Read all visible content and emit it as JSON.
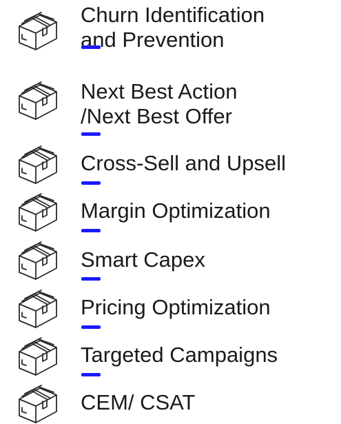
{
  "accent_color": "#1a1aff",
  "icon_name": "package-box-icon",
  "items": [
    {
      "line1": "Churn Identification",
      "line2": "and Prevention"
    },
    {
      "line1": "Next Best Action",
      "line2": "/Next Best Offer"
    },
    {
      "line1": "Cross-Sell and Upsell",
      "line2": ""
    },
    {
      "line1": "Margin Optimization",
      "line2": ""
    },
    {
      "line1": "Smart Capex",
      "line2": ""
    },
    {
      "line1": "Pricing Optimization",
      "line2": ""
    },
    {
      "line1": "Targeted Campaigns",
      "line2": ""
    },
    {
      "line1": "CEM/ CSAT",
      "line2": ""
    }
  ]
}
